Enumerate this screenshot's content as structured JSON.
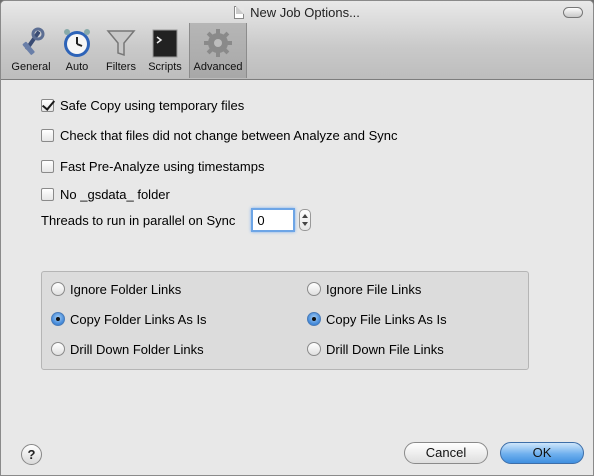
{
  "window": {
    "title": "New Job Options..."
  },
  "toolbar": {
    "items": [
      {
        "label": "General",
        "icon": "wrench-screwdriver-icon"
      },
      {
        "label": "Auto",
        "icon": "clock-icon"
      },
      {
        "label": "Filters",
        "icon": "funnel-icon"
      },
      {
        "label": "Scripts",
        "icon": "terminal-icon"
      },
      {
        "label": "Advanced",
        "icon": "gear-icon",
        "selected": true
      }
    ]
  },
  "options": {
    "safe_copy": {
      "label": "Safe Copy using temporary files",
      "checked": true
    },
    "check_files": {
      "label": "Check that files did not change between Analyze and Sync",
      "checked": false
    },
    "fast_preanalyze": {
      "label": "Fast Pre-Analyze using timestamps",
      "checked": false
    },
    "no_gsdata": {
      "label": "No _gsdata_ folder",
      "checked": false
    },
    "threads": {
      "label": "Threads to run in parallel on Sync",
      "value": "0"
    }
  },
  "links": {
    "folder": {
      "ignore": "Ignore Folder Links",
      "copy": "Copy Folder Links As Is",
      "drill": "Drill Down Folder Links",
      "selected": "copy"
    },
    "file": {
      "ignore": "Ignore File Links",
      "copy": "Copy File Links As Is",
      "drill": "Drill Down File Links",
      "selected": "copy"
    }
  },
  "footer": {
    "help": "?",
    "cancel": "Cancel",
    "ok": "OK"
  },
  "colors": {
    "focus_ring": "#6da5e6",
    "default_button": "#3f8fe0",
    "window_bg": "#e8e8e8"
  }
}
